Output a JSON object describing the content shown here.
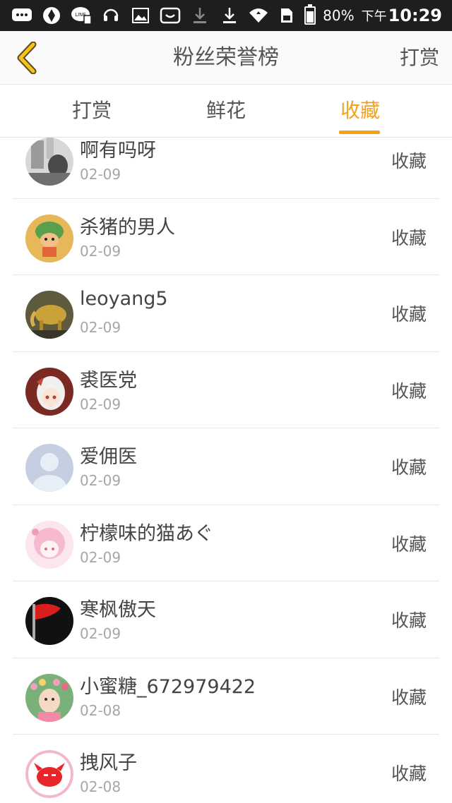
{
  "status_bar": {
    "battery": "80%",
    "time_prefix": "下午",
    "time": "10:29",
    "icons": [
      "chat-icon",
      "aperture-icon",
      "line-icon",
      "support-icon",
      "image-icon",
      "store-icon",
      "download-icon",
      "download-icon",
      "wifi-icon",
      "sim-icon",
      "battery-icon"
    ]
  },
  "header": {
    "title": "粉丝荣誉榜",
    "action": "打赏",
    "back_icon": "chevron-left-icon",
    "accent_color": "#f2a21b"
  },
  "tabs": [
    {
      "label": "打赏",
      "active": false
    },
    {
      "label": "鲜花",
      "active": false
    },
    {
      "label": "收藏",
      "active": true
    }
  ],
  "items": [
    {
      "name": "啊有吗呀",
      "date": "02-09",
      "action": "收藏"
    },
    {
      "name": "杀猪的男人",
      "date": "02-09",
      "action": "收藏"
    },
    {
      "name": "leoyang5",
      "date": "02-09",
      "action": "收藏"
    },
    {
      "name": "裘医党",
      "date": "02-09",
      "action": "收藏"
    },
    {
      "name": "爱佣医",
      "date": "02-09",
      "action": "收藏"
    },
    {
      "name": "柠檬味的猫あぐ",
      "date": "02-09",
      "action": "收藏"
    },
    {
      "name": "寒枫傲天",
      "date": "02-09",
      "action": "收藏"
    },
    {
      "name": "小蜜糖_672979422",
      "date": "02-08",
      "action": "收藏"
    },
    {
      "name": "拽风子",
      "date": "02-08",
      "action": "收藏"
    }
  ]
}
